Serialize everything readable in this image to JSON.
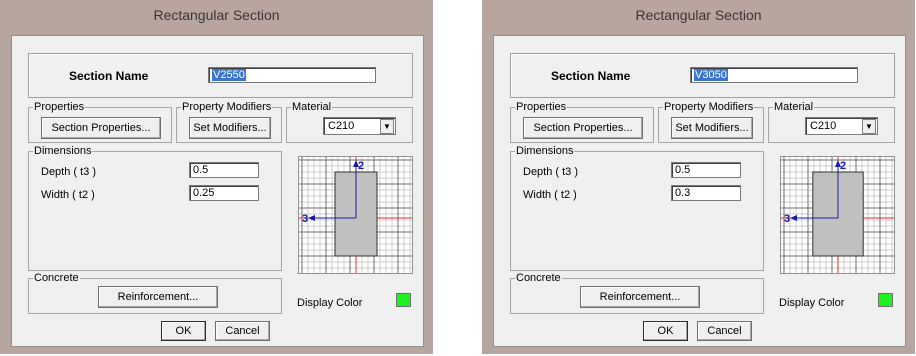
{
  "dialogs": [
    {
      "title": "Rectangular Section",
      "section_name_label": "Section Name",
      "section_name_value": "V2550",
      "properties_label": "Properties",
      "section_properties_button": "Section Properties...",
      "property_modifiers_label": "Property Modifiers",
      "set_modifiers_button": "Set Modifiers...",
      "material_label": "Material",
      "material_value": "C210",
      "dimensions_label": "Dimensions",
      "depth_label": "Depth ( t3 )",
      "depth_value": "0.5",
      "width_label": "Width ( t2 )",
      "width_value": "0.25",
      "concrete_label": "Concrete",
      "reinforcement_button": "Reinforcement...",
      "display_color_label": "Display Color",
      "ok_button": "OK",
      "cancel_button": "Cancel",
      "axis2_label": "2",
      "axis3_label": "3"
    },
    {
      "title": "Rectangular Section",
      "section_name_label": "Section Name",
      "section_name_value": "V3050",
      "properties_label": "Properties",
      "section_properties_button": "Section Properties...",
      "property_modifiers_label": "Property Modifiers",
      "set_modifiers_button": "Set Modifiers...",
      "material_label": "Material",
      "material_value": "C210",
      "dimensions_label": "Dimensions",
      "depth_label": "Depth ( t3 )",
      "depth_value": "0.5",
      "width_label": "Width ( t2 )",
      "width_value": "0.3",
      "concrete_label": "Concrete",
      "reinforcement_button": "Reinforcement...",
      "display_color_label": "Display Color",
      "ok_button": "OK",
      "cancel_button": "Cancel",
      "axis2_label": "2",
      "axis3_label": "3"
    }
  ],
  "colors": {
    "display_color": "#1ff01f",
    "section_fill": "#c0c0c0",
    "axis_color": "#1a1aa8",
    "centerline_color": "#e03030"
  }
}
